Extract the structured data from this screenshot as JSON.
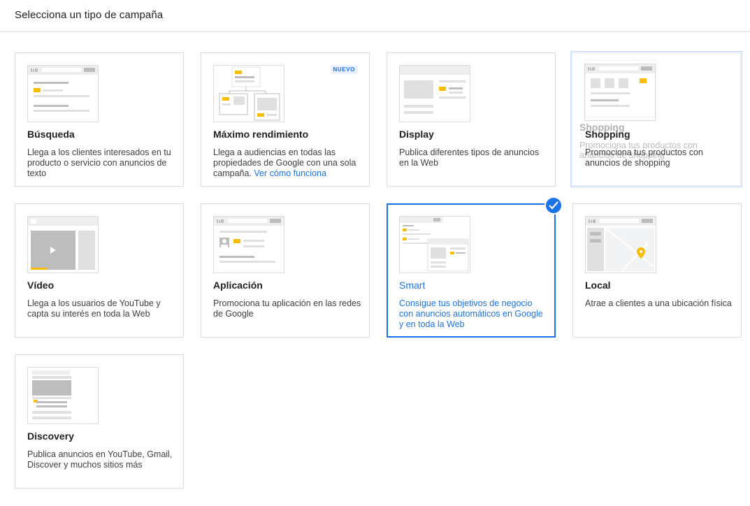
{
  "header": {
    "title": "Selecciona un tipo de campaña"
  },
  "cards": [
    {
      "title": "Búsqueda",
      "desc": "Llega a los clientes interesados en tu producto o servicio con anuncios de texto"
    },
    {
      "title": "Máximo rendimiento",
      "badge": "NUEVO",
      "desc": "Llega a audiencias en todas las propiedades de Google con una sola campaña.",
      "link": "Ver cómo funciona"
    },
    {
      "title": "Display",
      "desc": "Publica diferentes tipos de anuncios en la Web"
    },
    {
      "title": "Shopping",
      "desc": "Promociona tus productos con anuncios de shopping",
      "ghost_title": "Shopping",
      "ghost_desc": "Promociona tus productos con anuncios de shopping"
    },
    {
      "title": "Vídeo",
      "desc": "Llega a los usuarios de YouTube y capta su interés en toda la Web"
    },
    {
      "title": "Aplicación",
      "desc": "Promociona tu aplicación en las redes de Google"
    },
    {
      "title": "Smart",
      "desc": "Consigue tus objetivos de negocio con anuncios automáticos en Google y en toda la Web",
      "selected": true
    },
    {
      "title": "Local",
      "desc": "Atrae a clientes a una ubicación física"
    },
    {
      "title": "Discovery",
      "desc": "Publica anuncios en YouTube, Gmail, Discover y muchos sitios más"
    }
  ],
  "colors": {
    "accent": "#1a73e8",
    "yellow": "#fbbc04",
    "border": "#dadce0",
    "placeholder": "#e0e0e0"
  }
}
